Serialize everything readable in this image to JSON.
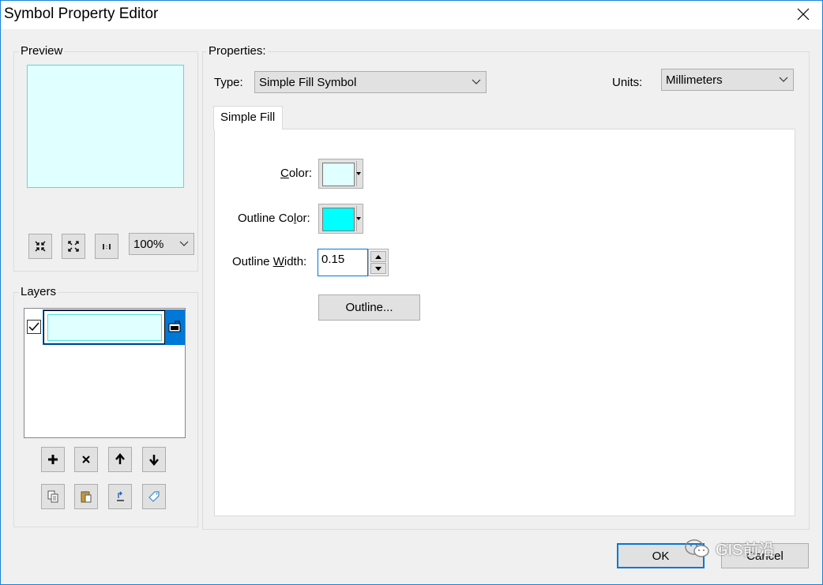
{
  "window": {
    "title": "Symbol Property Editor"
  },
  "preview": {
    "group_label": "Preview",
    "fill_color": "#e0ffff",
    "outline_color": "#4ee0e0",
    "zoom_value": "100%",
    "tools": [
      "fit-icon",
      "full-extent-icon",
      "actual-size-icon"
    ]
  },
  "layers": {
    "group_label": "Layers",
    "items": [
      {
        "checked": true,
        "selected": true
      }
    ],
    "selection_color": "#0078d7"
  },
  "properties": {
    "group_label": "Properties:",
    "type_label": "Type:",
    "type_value": "Simple Fill Symbol",
    "units_label": "Units:",
    "units_value": "Millimeters",
    "tab_label": "Simple Fill",
    "color_label_pre": "",
    "color_label_key": "C",
    "color_label_post": "olor:",
    "color_value": "#e0ffff",
    "outline_color_label_pre": "Outline Co",
    "outline_color_label_key": "l",
    "outline_color_label_post": "or:",
    "outline_color_value": "#00ffff",
    "outline_width_label_pre": "Outline ",
    "outline_width_label_key": "W",
    "outline_width_label_post": "idth:",
    "outline_width_value": "0.15",
    "outline_button": "Outline..."
  },
  "footer": {
    "ok": "OK",
    "cancel": "Cancel",
    "watermark": "GIS前沿"
  }
}
